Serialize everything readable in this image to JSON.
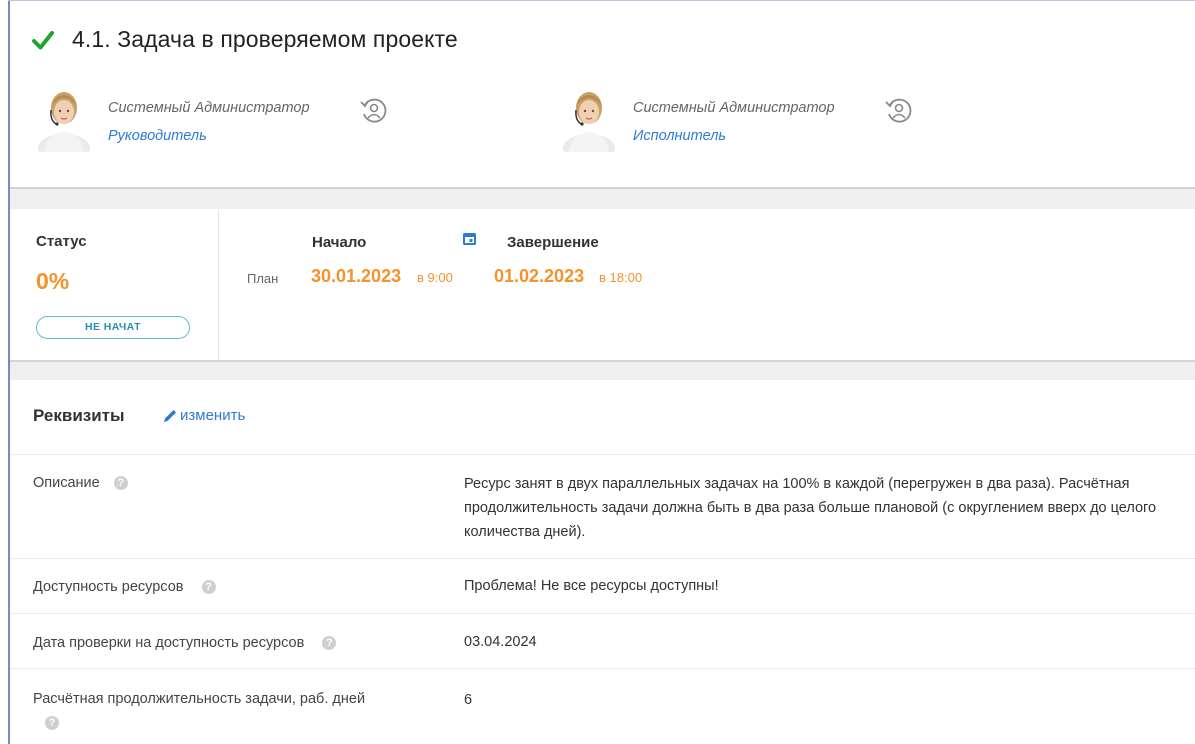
{
  "task": {
    "title": "4.1. Задача в проверяемом проекте"
  },
  "people": [
    {
      "name": "Системный Администратор",
      "role": "Руководитель"
    },
    {
      "name": "Системный Администратор",
      "role": "Исполнитель"
    }
  ],
  "status": {
    "label": "Статус",
    "percent": "0%",
    "badge": "НЕ НАЧАТ"
  },
  "schedule": {
    "start_label": "Начало",
    "end_label": "Завершение",
    "plan_label": "План",
    "start_date": "30.01.2023",
    "start_time": "в 9:00",
    "end_date": "01.02.2023",
    "end_time": "в 18:00"
  },
  "details": {
    "title": "Реквизиты",
    "edit_label": "изменить",
    "rows": [
      {
        "label": "Описание",
        "value": "Ресурс занят в двух параллельных задачах на 100% в каждой (перегружен в два раза). Расчётная продолжительность задачи должна быть в два раза больше плановой (с округлением вверх до целого количества дней)."
      },
      {
        "label": "Доступность ресурсов",
        "value": "Проблема! Не все ресурсы доступны!"
      },
      {
        "label": "Дата проверки на доступность ресурсов",
        "value": "03.04.2024"
      },
      {
        "label": "Расчётная продолжительность задачи, раб. дней",
        "value": "6"
      }
    ]
  },
  "icons": {
    "check": "check-icon",
    "swap": "reassign-user-icon",
    "calendar": "calendar-icon",
    "edit": "pencil-icon",
    "help": "help-icon"
  },
  "colors": {
    "accent_orange": "#f5922a",
    "link_blue": "#2f7ad3",
    "check_green": "#1fa52b",
    "badge_border": "#5bbfd6"
  }
}
